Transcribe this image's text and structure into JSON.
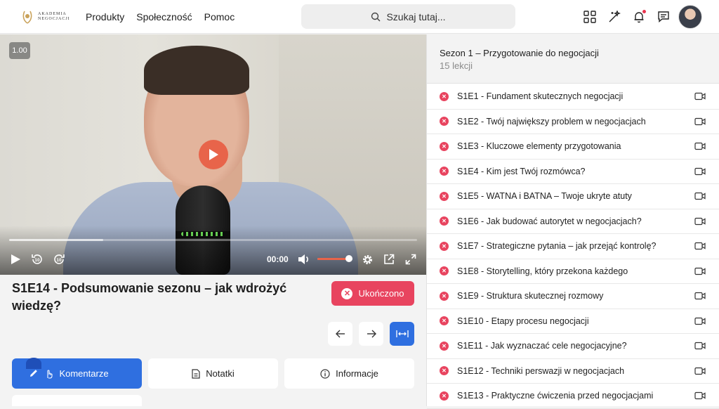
{
  "header": {
    "logo_text": "Akademia Negocjacji",
    "nav": [
      "Produkty",
      "Społeczność",
      "Pomoc"
    ],
    "search_placeholder": "Szukaj tutaj...",
    "icons": [
      "grid-icon",
      "magic-wand-icon",
      "bell-icon",
      "chat-icon"
    ]
  },
  "video": {
    "speed": "1.00",
    "time": "00:00",
    "buffered_fraction": 0.23,
    "volume_fraction": 0.9
  },
  "lesson": {
    "title": "S1E14 - Podsumowanie sezonu – jak wdrożyć wiedzę?",
    "status_label": "Ukończono",
    "tabs": [
      "Komentarze",
      "Notatki",
      "Informacje"
    ]
  },
  "sidebar": {
    "season_title": "Sezon 1 – Przygotowanie do negocjacji",
    "season_count": "15 lekcji",
    "lessons": [
      "S1E1 - Fundament skutecznych negocjacji",
      "S1E2 - Twój największy problem w negocjacjach",
      "S1E3 - Kluczowe elementy przygotowania",
      "S1E4 - Kim jest Twój rozmówca?",
      "S1E5 - WATNA i BATNA – Twoje ukryte atuty",
      "S1E6 - Jak budować autorytet w negocjacjach?",
      "S1E7 - Strategiczne pytania – jak przejąć kontrolę?",
      "S1E8 - Storytelling, który przekona każdego",
      "S1E9 - Struktura skutecznej rozmowy",
      "S1E10 - Etapy procesu negocjacji",
      "S1E11 - Jak wyznaczać cele negocjacyjne?",
      "S1E12 - Techniki perswazji w negocjacjach",
      "S1E13 - Praktyczne ćwiczenia przed negocjacjami"
    ]
  },
  "colors": {
    "accent_blue": "#2f6fe0",
    "accent_red": "#e8445f",
    "play_orange": "#e8644a"
  }
}
